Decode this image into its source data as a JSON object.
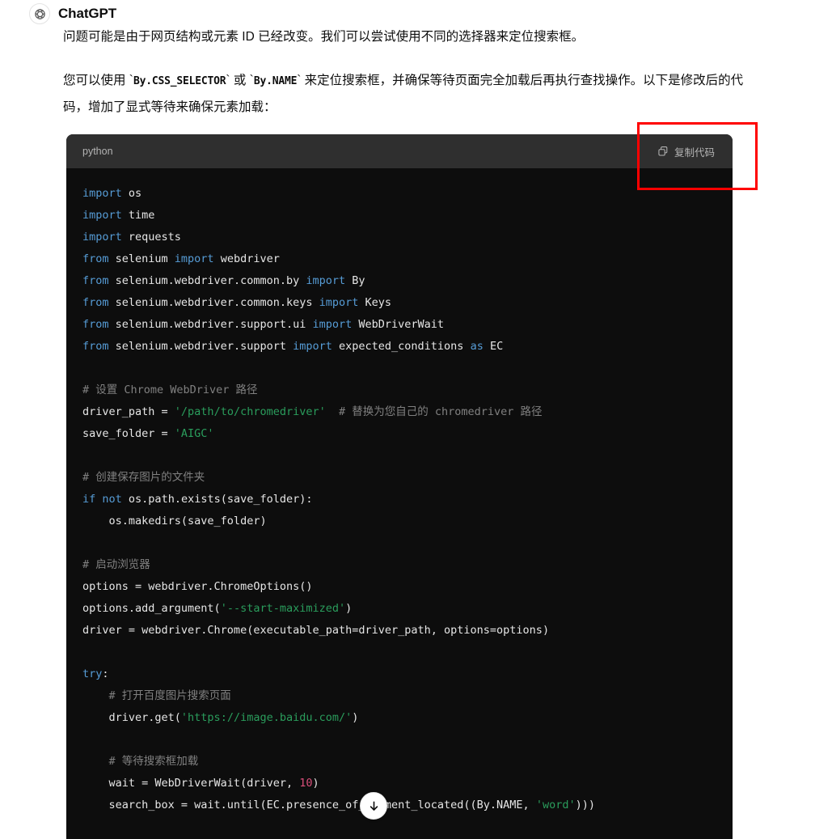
{
  "message": {
    "assistant_name": "ChatGPT",
    "avatar_icon": "openai-logo-icon",
    "paragraphs": [
      "问题可能是由于网页结构或元素 ID 已经改变。我们可以尝试使用不同的选择器来定位搜索框。"
    ],
    "paragraph2": {
      "part1": "您可以使用 `",
      "code1": "By.CSS_SELECTOR",
      "part2": "` 或 `",
      "code2": "By.NAME",
      "part3": "` 来定位搜索框，并确保等待页面完全加载后再执行查找操作。以下是修改后的代码，增加了显式等待来确保元素加载："
    }
  },
  "code_block": {
    "language_label": "python",
    "copy_button_label": "复制代码",
    "copy_icon": "copy-icon",
    "lines": [
      [
        {
          "t": "import",
          "c": "kw"
        },
        {
          "t": " os",
          "c": "plain"
        }
      ],
      [
        {
          "t": "import",
          "c": "kw"
        },
        {
          "t": " time",
          "c": "plain"
        }
      ],
      [
        {
          "t": "import",
          "c": "kw"
        },
        {
          "t": " requests",
          "c": "plain"
        }
      ],
      [
        {
          "t": "from",
          "c": "kw"
        },
        {
          "t": " selenium ",
          "c": "plain"
        },
        {
          "t": "import",
          "c": "kw"
        },
        {
          "t": " webdriver",
          "c": "plain"
        }
      ],
      [
        {
          "t": "from",
          "c": "kw"
        },
        {
          "t": " selenium.webdriver.common.by ",
          "c": "plain"
        },
        {
          "t": "import",
          "c": "kw"
        },
        {
          "t": " By",
          "c": "plain"
        }
      ],
      [
        {
          "t": "from",
          "c": "kw"
        },
        {
          "t": " selenium.webdriver.common.keys ",
          "c": "plain"
        },
        {
          "t": "import",
          "c": "kw"
        },
        {
          "t": " Keys",
          "c": "plain"
        }
      ],
      [
        {
          "t": "from",
          "c": "kw"
        },
        {
          "t": " selenium.webdriver.support.ui ",
          "c": "plain"
        },
        {
          "t": "import",
          "c": "kw"
        },
        {
          "t": " WebDriverWait",
          "c": "plain"
        }
      ],
      [
        {
          "t": "from",
          "c": "kw"
        },
        {
          "t": " selenium.webdriver.support ",
          "c": "plain"
        },
        {
          "t": "import",
          "c": "kw"
        },
        {
          "t": " expected_conditions ",
          "c": "plain"
        },
        {
          "t": "as",
          "c": "kw"
        },
        {
          "t": " EC",
          "c": "plain"
        }
      ],
      [],
      [
        {
          "t": "# 设置 Chrome WebDriver 路径",
          "c": "cmt"
        }
      ],
      [
        {
          "t": "driver_path = ",
          "c": "plain"
        },
        {
          "t": "'/path/to/chromedriver'",
          "c": "str"
        },
        {
          "t": "  ",
          "c": "plain"
        },
        {
          "t": "# 替换为您自己的 chromedriver 路径",
          "c": "cmt"
        }
      ],
      [
        {
          "t": "save_folder = ",
          "c": "plain"
        },
        {
          "t": "'AIGC'",
          "c": "str"
        }
      ],
      [],
      [
        {
          "t": "# 创建保存图片的文件夹",
          "c": "cmt"
        }
      ],
      [
        {
          "t": "if",
          "c": "kw"
        },
        {
          "t": " ",
          "c": "plain"
        },
        {
          "t": "not",
          "c": "kw"
        },
        {
          "t": " os.path.exists(save_folder):",
          "c": "plain"
        }
      ],
      [
        {
          "t": "    os.makedirs(save_folder)",
          "c": "plain"
        }
      ],
      [],
      [
        {
          "t": "# 启动浏览器",
          "c": "cmt"
        }
      ],
      [
        {
          "t": "options = webdriver.ChromeOptions()",
          "c": "plain"
        }
      ],
      [
        {
          "t": "options.add_argument(",
          "c": "plain"
        },
        {
          "t": "'--start-maximized'",
          "c": "str"
        },
        {
          "t": ")",
          "c": "plain"
        }
      ],
      [
        {
          "t": "driver = webdriver.Chrome(executable_path=driver_path, options=options)",
          "c": "plain"
        }
      ],
      [],
      [
        {
          "t": "try",
          "c": "kw"
        },
        {
          "t": ":",
          "c": "plain"
        }
      ],
      [
        {
          "t": "    ",
          "c": "plain"
        },
        {
          "t": "# 打开百度图片搜索页面",
          "c": "cmt"
        }
      ],
      [
        {
          "t": "    driver.get(",
          "c": "plain"
        },
        {
          "t": "'https://image.baidu.com/'",
          "c": "str"
        },
        {
          "t": ")",
          "c": "plain"
        }
      ],
      [],
      [
        {
          "t": "    ",
          "c": "plain"
        },
        {
          "t": "# 等待搜索框加载",
          "c": "cmt"
        }
      ],
      [
        {
          "t": "    wait = WebDriverWait(driver, ",
          "c": "plain"
        },
        {
          "t": "10",
          "c": "num"
        },
        {
          "t": ")",
          "c": "plain"
        }
      ],
      [
        {
          "t": "    search_box = wait.until(EC.presence_of_element_located((By.NAME, ",
          "c": "plain"
        },
        {
          "t": "'word'",
          "c": "str"
        },
        {
          "t": ")))",
          "c": "plain"
        }
      ]
    ]
  },
  "annotation": {
    "shape": "rectangle",
    "color": "#ff0000",
    "target": "copy-code-button"
  },
  "scroll_button": {
    "icon": "arrow-down-icon",
    "label": "滚动到底部"
  },
  "colors": {
    "page_background": "#ffffff",
    "code_background": "#0d0d0d",
    "code_header_background": "#2f2f2f",
    "text": "#0d0d0d",
    "muted_text": "#b4b4b4",
    "keyword": "#569cd6",
    "string": "#2a9d5c",
    "comment": "#808080",
    "number": "#d94f7a",
    "annotation": "#ff0000"
  }
}
